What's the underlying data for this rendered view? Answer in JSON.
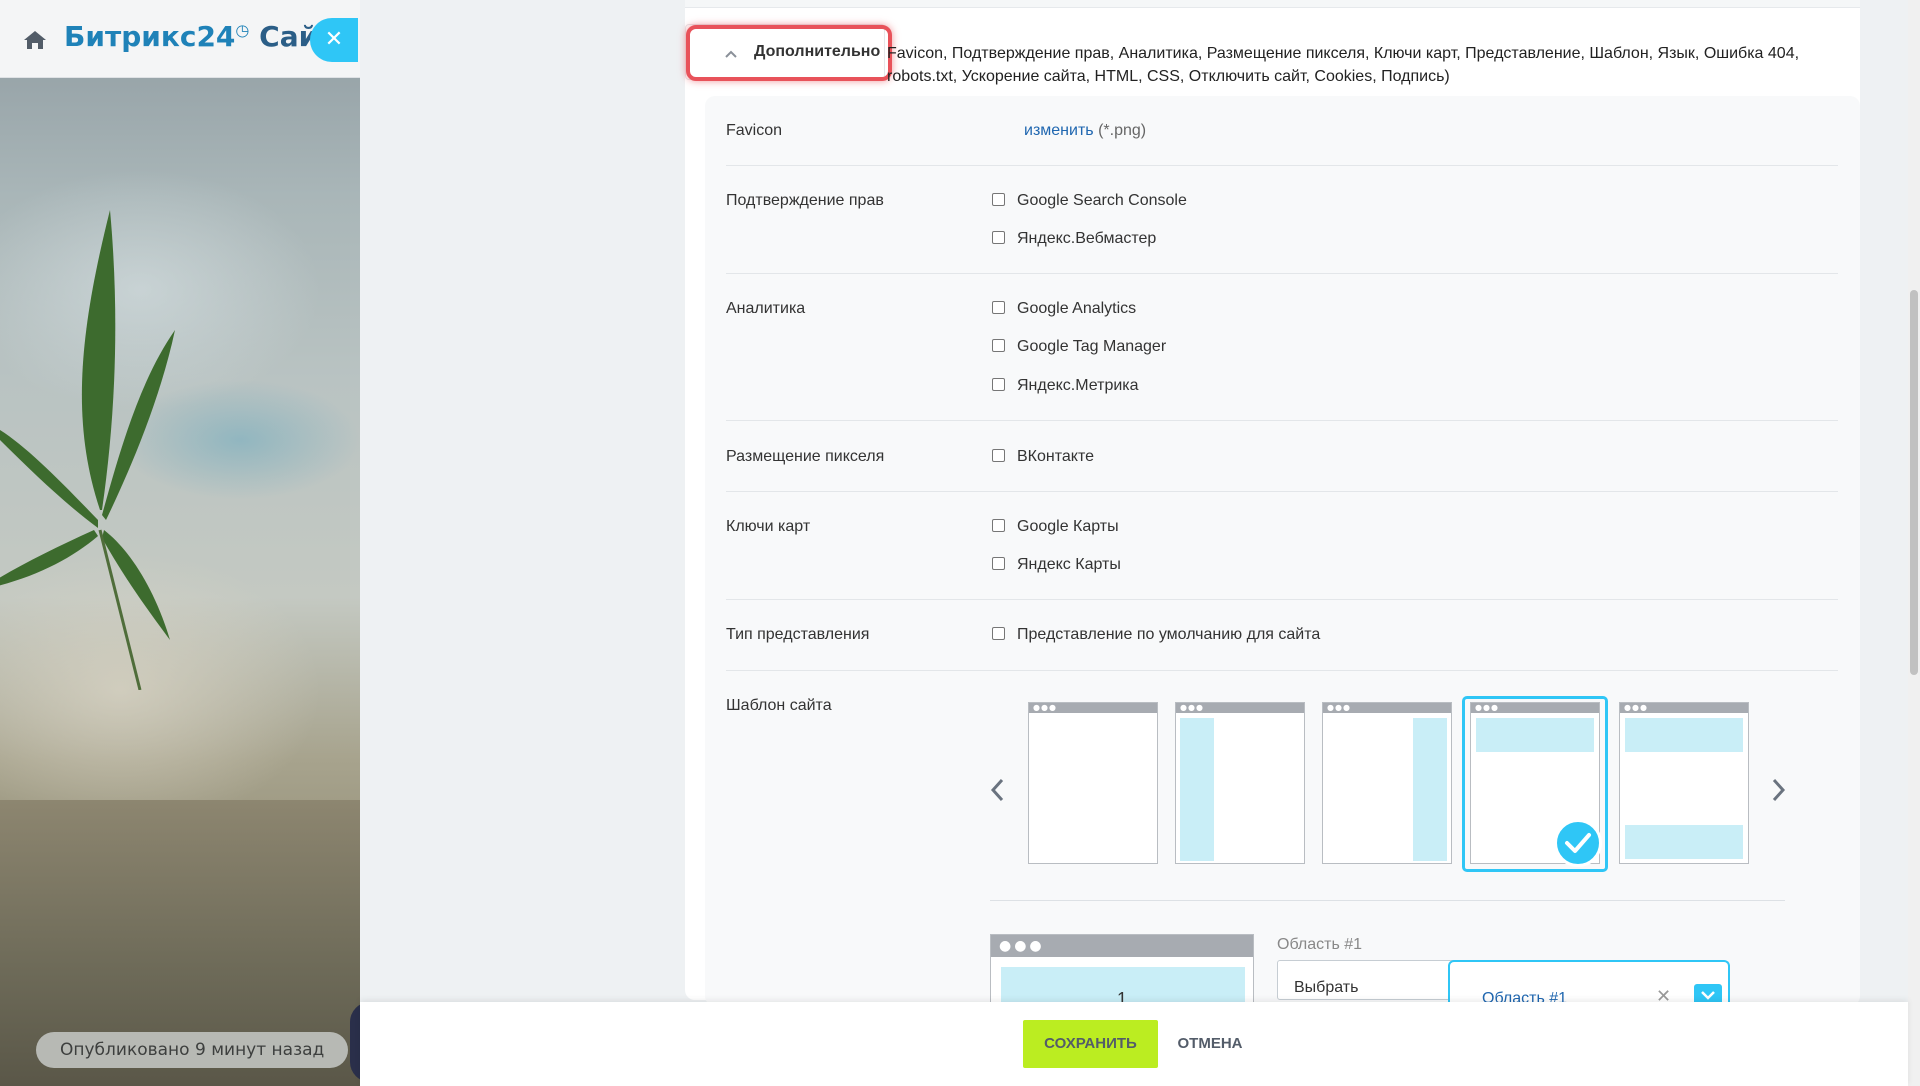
{
  "background_page": {
    "brand_name": "Битрикс24",
    "brand_product": "Сайты",
    "published_status": "Опубликовано 9 минут назад"
  },
  "section": {
    "title": "Дополнительно",
    "summary": "Favicon,  Подтверждение прав,  Аналитика,  Размещение пикселя,  Ключи карт,  Представление,  Шаблон,  Язык,  Ошибка 404,  robots.txt,  Ускорение сайта,  HTML,  CSS,  Отключить сайт,  Cookies,  Подпись)"
  },
  "settings": {
    "favicon": {
      "label": "Favicon",
      "change_link": "изменить",
      "extension": "(*.png)"
    },
    "rights": {
      "label": "Подтверждение прав",
      "options": [
        "Google Search Console",
        "Яндекс.Вебмастер"
      ]
    },
    "analytics": {
      "label": "Аналитика",
      "options": [
        "Google Analytics",
        "Google Tag Manager",
        "Яндекс.Метрика"
      ]
    },
    "pixel": {
      "label": "Размещение пикселя",
      "options": [
        "ВКонтакте"
      ]
    },
    "map_keys": {
      "label": "Ключи карт",
      "options": [
        "Google Карты",
        "Яндекс Карты"
      ]
    },
    "view_type": {
      "label": "Тип представления",
      "options": [
        "Представление по умолчанию для сайта"
      ]
    },
    "site_template": {
      "label": "Шаблон сайта",
      "selected_index": 3,
      "area_preview_number": "1",
      "area_label": "Область #1",
      "select_placeholder": "Выбрать",
      "area_value": "Область #1"
    }
  },
  "footer": {
    "save_label": "СОХРАНИТЬ",
    "cancel_label": "ОТМЕНА"
  },
  "colors": {
    "accent": "#2fc6f6",
    "save_button": "#bbed21",
    "highlight": "#e8525a",
    "link": "#2067b0"
  }
}
